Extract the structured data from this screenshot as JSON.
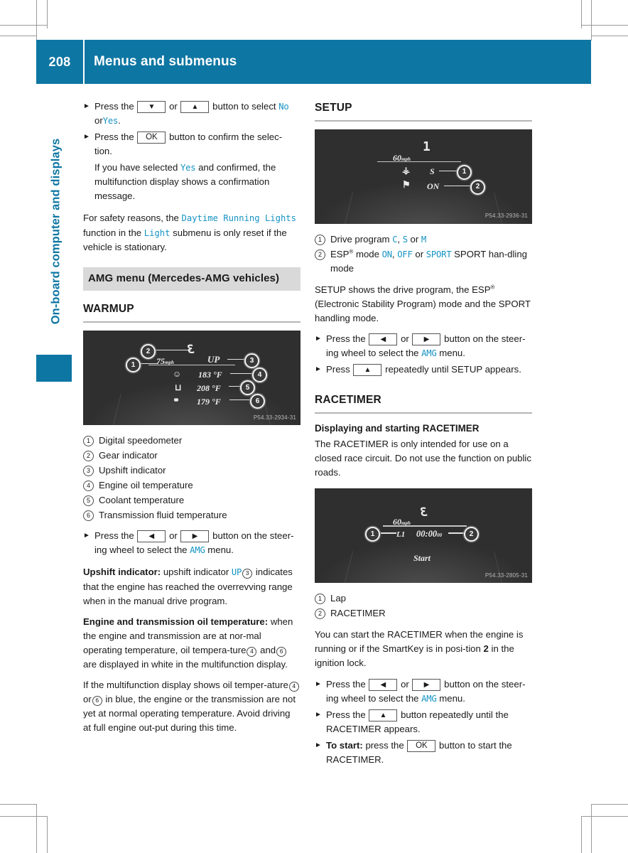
{
  "page": {
    "number": "208",
    "header_title": "Menus and submenus",
    "side_label": "On-board computer and displays",
    "accent_color": "#0e76a3",
    "display_text_color": "#1593c4"
  },
  "left_column": {
    "step_select": {
      "prefix": "Press the",
      "key_down": "▼",
      "or": "or",
      "key_up": "▲",
      "middle": "button to select",
      "value_no": "No",
      "conj": "or",
      "value_yes": "Yes",
      "period": "."
    },
    "step_confirm": {
      "prefix": "Press the",
      "key_ok": "OK",
      "suffix": "button to confirm the selec-"
    },
    "step_confirm_cont": "tion.",
    "step_note": {
      "part1": "If you have selected",
      "value_yes": "Yes",
      "part2": "and confirmed, the multifunction display shows a confirmation message."
    },
    "safety_note": {
      "part1": "For safety reasons, the",
      "term1": "Daytime Running Lights",
      "part2": "function in the",
      "term2": "Light",
      "part3": "submenu is only reset if the vehicle is stationary."
    },
    "chapter_band": "AMG menu (Mercedes-AMG vehicles)",
    "warmup_heading": "WARMUP",
    "warmup_figure": {
      "code": "P54.33-2934-31",
      "speed": "75",
      "speed_unit": "mph",
      "gear": "3",
      "upshift": "UP",
      "oil_temp": "183 °F",
      "coolant_temp": "208 °F",
      "trans_temp": "179 °F",
      "callouts": [
        "1",
        "2",
        "3",
        "4",
        "5",
        "6"
      ]
    },
    "warmup_legend": [
      {
        "num": "1",
        "text": "Digital speedometer"
      },
      {
        "num": "2",
        "text": "Gear indicator"
      },
      {
        "num": "3",
        "text": "Upshift indicator"
      },
      {
        "num": "4",
        "text": "Engine oil temperature"
      },
      {
        "num": "5",
        "text": "Coolant temperature"
      },
      {
        "num": "6",
        "text": "Transmission fluid temperature"
      }
    ],
    "step_amg": {
      "prefix": "Press the",
      "key_left": "◀",
      "or": "or",
      "key_right": "▶",
      "middle": "button on the steer-",
      "line2_pre": "ing wheel to select the",
      "term_amg": "AMG",
      "line2_post": "menu."
    },
    "upshift_para": {
      "bold": "Upshift indicator:",
      "part1": "upshift indicator",
      "term_up": "UP",
      "ref": "3",
      "part2": "indicates that the engine has reached the overrevving range when in the manual drive program."
    },
    "engine_temp_para": {
      "bold": "Engine and transmission oil temperature:",
      "part1": "when the engine and transmission are at nor-mal operating temperature, oil tempera-ture",
      "ref1": "4",
      "mid": "and",
      "ref2": "6",
      "part2": "are displayed in white in the multifunction display."
    },
    "blue_temp_para": {
      "part1": "If the multifunction display shows oil temper-ature",
      "ref1": "4",
      "mid": "or",
      "ref2": "6",
      "part2": "in blue, the engine or the transmission are not yet at normal operating temperature. Avoid driving at full engine out-put during this time."
    }
  },
  "right_column": {
    "setup_heading": "SETUP",
    "setup_figure": {
      "code": "P54.33-2936-31",
      "speed": "60",
      "speed_unit": "mph",
      "gear": "1",
      "drive_program": "S",
      "esp_mode": "ON",
      "callouts": [
        "1",
        "2"
      ]
    },
    "setup_legend": [
      {
        "num": "1",
        "prefix": "Drive program",
        "v1": "C",
        "sep1": ",",
        "v2": "S",
        "sep2": "or",
        "v3": "M"
      },
      {
        "num": "2",
        "prefix": "ESP",
        "sup": "®",
        "mode": "mode",
        "v1": "ON",
        "sep1": ",",
        "v2": "OFF",
        "sep2": "or",
        "v3": "SPORT",
        "suffix": "SPORT han-dling mode"
      }
    ],
    "setup_para": {
      "part1": "SETUP shows the drive program, the ESP",
      "sup": "®",
      "part2": "(Electronic Stability Program) mode and the SPORT handling mode."
    },
    "setup_step_amg": {
      "prefix": "Press the",
      "key_left": "◀",
      "or": "or",
      "key_right": "▶",
      "middle": "button on the steer-",
      "line2_pre": "ing wheel to select the",
      "term_amg": "AMG",
      "line2_post": "menu."
    },
    "setup_step_up": {
      "prefix": "Press",
      "key_up": "▲",
      "suffix": "repeatedly until SETUP",
      "line2": "appears."
    },
    "racetimer_heading": "RACETIMER",
    "racetimer_subheading": "Displaying and starting RACETIMER",
    "racetimer_warning": "The RACETIMER is only intended for use on a closed race circuit. Do not use the function on public roads.",
    "racetimer_figure": {
      "code": "P54.33-2805-31",
      "speed": "60",
      "speed_unit": "mph",
      "gear": "3",
      "lap": "L1",
      "time": "00:00",
      "time_frac": "00",
      "start": "Start",
      "callouts": [
        "1",
        "2"
      ]
    },
    "racetimer_legend": [
      {
        "num": "1",
        "text": "Lap"
      },
      {
        "num": "2",
        "text": "RACETIMER"
      }
    ],
    "racetimer_para": {
      "part1": "You can start the RACETIMER when the engine is running or if the SmartKey is in posi-tion",
      "bold": "2",
      "part2": "in the ignition lock."
    },
    "rt_step_amg": {
      "prefix": "Press the",
      "key_left": "◀",
      "or": "or",
      "key_right": "▶",
      "middle": "button on the steer-",
      "line2_pre": "ing wheel to select the",
      "term_amg": "AMG",
      "line2_post": "menu."
    },
    "rt_step_up": {
      "prefix": "Press the",
      "key_up": "▲",
      "suffix": "button repeatedly until the",
      "line2": "RACETIMER appears."
    },
    "rt_step_start": {
      "bold": "To start:",
      "part1": "press the",
      "key_ok": "OK",
      "part2": "button to start the",
      "line2": "RACETIMER."
    }
  }
}
